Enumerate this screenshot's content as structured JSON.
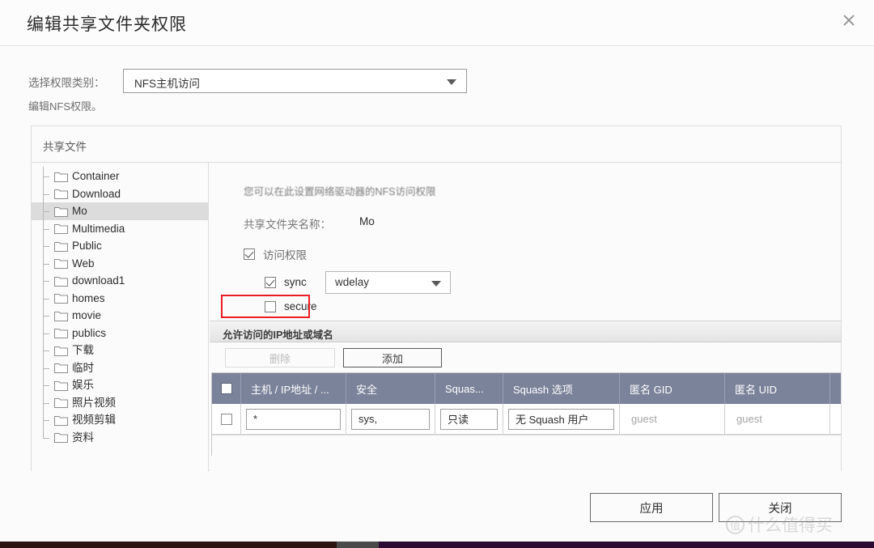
{
  "window": {
    "title": "编辑共享文件夹权限",
    "close_icon": "close-icon"
  },
  "form": {
    "category_label": "选择权限类别：",
    "category_value": "NFS主机访问",
    "category_caret_icon": "chevron-down-icon",
    "hint": "编辑NFS权限。"
  },
  "panel": {
    "header": "共享文件",
    "tree": {
      "items": [
        {
          "label": "Container",
          "selected": false
        },
        {
          "label": "Download",
          "selected": false
        },
        {
          "label": "Mo",
          "selected": true
        },
        {
          "label": "Multimedia",
          "selected": false
        },
        {
          "label": "Public",
          "selected": false
        },
        {
          "label": "Web",
          "selected": false
        },
        {
          "label": "download1",
          "selected": false
        },
        {
          "label": "homes",
          "selected": false
        },
        {
          "label": "movie",
          "selected": false
        },
        {
          "label": "publics",
          "selected": false
        },
        {
          "label": "下载",
          "selected": false
        },
        {
          "label": "临时",
          "selected": false
        },
        {
          "label": "娱乐",
          "selected": false
        },
        {
          "label": "照片视频",
          "selected": false
        },
        {
          "label": "视频剪辑",
          "selected": false
        },
        {
          "label": "资料",
          "selected": false
        }
      ]
    },
    "content": {
      "description": "您可以在此设置网络驱动器的NFS访问权限",
      "folder_name_label": "共享文件夹名称：",
      "folder_name_value": "Mo",
      "access_permission_label": "访问权限",
      "access_permission_checked": true,
      "sync_label": "sync",
      "sync_checked": true,
      "sync_select_value": "wdelay",
      "sync_select_caret_icon": "chevron-down-icon",
      "secure_label": "secure",
      "secure_checked": false,
      "highlight_color": "#ec1c24"
    },
    "ip_section": {
      "header": "允许访问的IP地址或域名",
      "delete_button": "删除",
      "delete_disabled": true,
      "add_button": "添加",
      "table": {
        "columns": [
          "主机 / IP地址 / ...",
          "安全",
          "Squas...",
          "Squash 选项",
          "匿名 GID",
          "匿名 UID"
        ],
        "rows": [
          {
            "selected": false,
            "host": "*",
            "security": "sys,",
            "squash": "只读",
            "squash_option": "无 Squash 用户",
            "anon_gid": "guest",
            "anon_uid": "guest"
          }
        ],
        "header_color": "#7b839a"
      }
    }
  },
  "footer": {
    "apply_button": "应用",
    "close_button": "关闭"
  },
  "watermark": {
    "logo": "值",
    "text": "什么值得买"
  }
}
